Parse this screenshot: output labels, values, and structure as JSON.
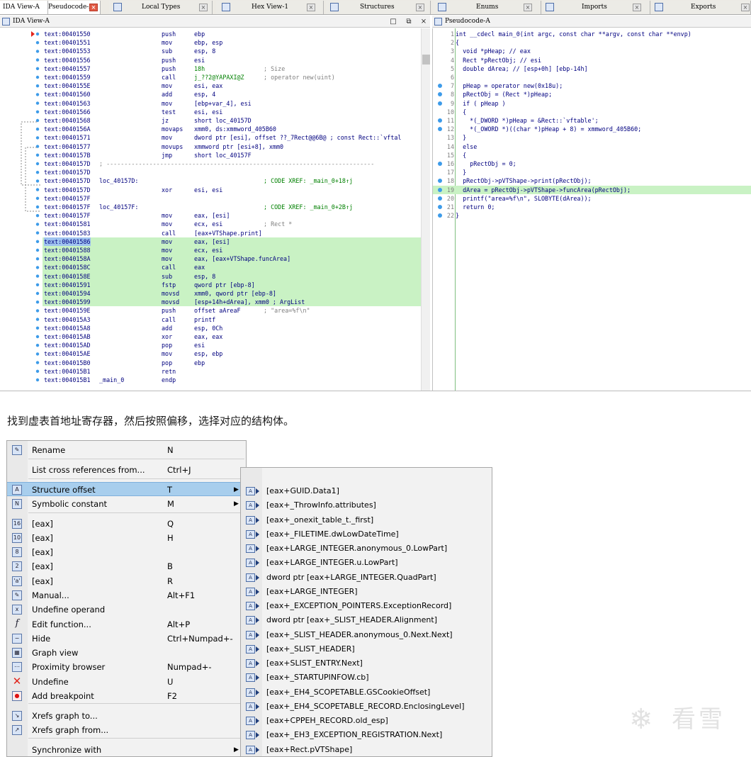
{
  "tabs": [
    {
      "label": "IDA View-A",
      "close": "×"
    },
    {
      "label": "Pseudocode-A",
      "close": "×"
    },
    {
      "label": "Local Types",
      "close": "×"
    },
    {
      "label": "Hex View-1",
      "close": "×"
    },
    {
      "label": "Structures",
      "close": "×"
    },
    {
      "label": "Enums",
      "close": "×"
    },
    {
      "label": "Imports",
      "close": "×"
    },
    {
      "label": "Exports",
      "close": "×"
    }
  ],
  "left_pane": {
    "title": "IDA View-A",
    "controls": [
      "□",
      "⧉",
      "×"
    ],
    "lines": [
      {
        "addr": "text:00401550",
        "label": "",
        "mn": "push",
        "op": "ebp",
        "cm": ""
      },
      {
        "addr": "text:00401551",
        "label": "",
        "mn": "mov",
        "op": "ebp, esp",
        "cm": ""
      },
      {
        "addr": "text:00401553",
        "label": "",
        "mn": "sub",
        "op": "esp, 8",
        "cm": ""
      },
      {
        "addr": "text:00401556",
        "label": "",
        "mn": "push",
        "op": "esi",
        "cm": ""
      },
      {
        "addr": "text:00401557",
        "label": "",
        "mn": "push",
        "op": "18h",
        "cm": "; Size"
      },
      {
        "addr": "text:00401559",
        "label": "",
        "mn": "call",
        "op": "j_??2@YAPAXI@Z",
        "cm": "; operator new(uint)"
      },
      {
        "addr": "text:0040155E",
        "label": "",
        "mn": "mov",
        "op": "esi, eax",
        "cm": ""
      },
      {
        "addr": "text:00401560",
        "label": "",
        "mn": "add",
        "op": "esp, 4",
        "cm": ""
      },
      {
        "addr": "text:00401563",
        "label": "",
        "mn": "mov",
        "op": "[ebp+var_4], esi",
        "cm": ""
      },
      {
        "addr": "text:00401566",
        "label": "",
        "mn": "test",
        "op": "esi, esi",
        "cm": ""
      },
      {
        "addr": "text:00401568",
        "label": "",
        "mn": "jz",
        "op": "short loc_40157D",
        "cm": ""
      },
      {
        "addr": "text:0040156A",
        "label": "",
        "mn": "movaps",
        "op": "xmm0, ds:xmmword_405B60",
        "cm": ""
      },
      {
        "addr": "text:00401571",
        "label": "",
        "mn": "mov",
        "op": "dword ptr [esi], offset ??_7Rect@@6B@ ; const Rect::`vftal",
        "cm": ""
      },
      {
        "addr": "text:00401577",
        "label": "",
        "mn": "movups",
        "op": "xmmword ptr [esi+8], xmm0",
        "cm": ""
      },
      {
        "addr": "text:0040157B",
        "label": "",
        "mn": "jmp",
        "op": "short loc_40157F",
        "cm": ""
      },
      {
        "addr": "text:0040157D",
        "label": "; ---------------------------------------------------------------------------",
        "mn": "",
        "op": "",
        "cm": ""
      },
      {
        "addr": "text:0040157D",
        "label": "",
        "mn": "",
        "op": "",
        "cm": ""
      },
      {
        "addr": "text:0040157D",
        "label": "loc_40157D:",
        "mn": "",
        "op": "",
        "cm": "; CODE XREF: _main_0+18↑j"
      },
      {
        "addr": "text:0040157D",
        "label": "",
        "mn": "xor",
        "op": "esi, esi",
        "cm": ""
      },
      {
        "addr": "text:0040157F",
        "label": "",
        "mn": "",
        "op": "",
        "cm": ""
      },
      {
        "addr": "text:0040157F",
        "label": "loc_40157F:",
        "mn": "",
        "op": "",
        "cm": "; CODE XREF: _main_0+2B↑j"
      },
      {
        "addr": "text:0040157F",
        "label": "",
        "mn": "mov",
        "op": "eax, [esi]",
        "cm": ""
      },
      {
        "addr": "text:00401581",
        "label": "",
        "mn": "mov",
        "op": "ecx, esi",
        "cm": "; Rect *"
      },
      {
        "addr": "text:00401583",
        "label": "",
        "mn": "call",
        "op": "[eax+VTShape.print]",
        "cm": ""
      },
      {
        "addr": "text:00401586",
        "label": "",
        "mn": "mov",
        "op": "eax, [esi]",
        "cm": ""
      },
      {
        "addr": "text:00401588",
        "label": "",
        "mn": "mov",
        "op": "ecx, esi",
        "cm": ""
      },
      {
        "addr": "text:0040158A",
        "label": "",
        "mn": "mov",
        "op": "eax, [eax+VTShape.funcArea]",
        "cm": ""
      },
      {
        "addr": "text:0040158C",
        "label": "",
        "mn": "call",
        "op": "eax",
        "cm": ""
      },
      {
        "addr": "text:0040158E",
        "label": "",
        "mn": "sub",
        "op": "esp, 8",
        "cm": ""
      },
      {
        "addr": "text:00401591",
        "label": "",
        "mn": "fstp",
        "op": "qword ptr [ebp-8]",
        "cm": ""
      },
      {
        "addr": "text:00401594",
        "label": "",
        "mn": "movsd",
        "op": "xmm0, qword ptr [ebp-8]",
        "cm": ""
      },
      {
        "addr": "text:00401599",
        "label": "",
        "mn": "movsd",
        "op": "[esp+14h+dArea], xmm0 ; ArgList",
        "cm": ""
      },
      {
        "addr": "text:0040159E",
        "label": "",
        "mn": "push",
        "op": "offset aAreaF",
        "cm": "; \"area=%f\\n\""
      },
      {
        "addr": "text:004015A3",
        "label": "",
        "mn": "call",
        "op": "printf",
        "cm": ""
      },
      {
        "addr": "text:004015A8",
        "label": "",
        "mn": "add",
        "op": "esp, 0Ch",
        "cm": ""
      },
      {
        "addr": "text:004015AB",
        "label": "",
        "mn": "xor",
        "op": "eax, eax",
        "cm": ""
      },
      {
        "addr": "text:004015AD",
        "label": "",
        "mn": "pop",
        "op": "esi",
        "cm": ""
      },
      {
        "addr": "text:004015AE",
        "label": "",
        "mn": "mov",
        "op": "esp, ebp",
        "cm": ""
      },
      {
        "addr": "text:004015B0",
        "label": "",
        "mn": "pop",
        "op": "ebp",
        "cm": ""
      },
      {
        "addr": "text:004015B1",
        "label": "",
        "mn": "retn",
        "op": "",
        "cm": ""
      },
      {
        "addr": "text:004015B1",
        "label": "_main_0",
        "mn": "endp",
        "op": "",
        "cm": ""
      }
    ]
  },
  "right_pane": {
    "title": "Pseudocode-A",
    "lines": [
      {
        "n": "1",
        "code": "int __cdecl main_0(int argc, const char **argv, const char **envp)"
      },
      {
        "n": "2",
        "code": "{"
      },
      {
        "n": "3",
        "code": "  void *pHeap; // eax"
      },
      {
        "n": "4",
        "code": "  Rect *pRectObj; // esi"
      },
      {
        "n": "5",
        "code": "  double dArea; // [esp+0h] [ebp-14h]"
      },
      {
        "n": "6",
        "code": ""
      },
      {
        "n": "7",
        "code": "  pHeap = operator new(0x18u);"
      },
      {
        "n": "8",
        "code": "  pRectObj = (Rect *)pHeap;"
      },
      {
        "n": "9",
        "code": "  if ( pHeap )"
      },
      {
        "n": "10",
        "code": "  {"
      },
      {
        "n": "11",
        "code": "    *(_DWORD *)pHeap = &Rect::`vftable';"
      },
      {
        "n": "12",
        "code": "    *(_OWORD *)((char *)pHeap + 8) = xmmword_405B60;"
      },
      {
        "n": "13",
        "code": "  }"
      },
      {
        "n": "14",
        "code": "  else"
      },
      {
        "n": "15",
        "code": "  {"
      },
      {
        "n": "16",
        "code": "    pRectObj = 0;"
      },
      {
        "n": "17",
        "code": "  }"
      },
      {
        "n": "18",
        "code": "  pRectObj->pVTShape->print(pRectObj);"
      },
      {
        "n": "19",
        "code": "  dArea = pRectObj->pVTShape->funcArea(pRectObj);"
      },
      {
        "n": "20",
        "code": "  printf(\"area=%f\\n\", SLOBYTE(dArea));"
      },
      {
        "n": "21",
        "code": "  return 0;"
      },
      {
        "n": "22",
        "code": "}"
      }
    ]
  },
  "caption": "找到虚表首地址寄存器，然后按照偏移，选择对应的结构体。",
  "context_menu": {
    "items": [
      {
        "label": "Rename",
        "key": "N",
        "icon": "rename-icon",
        "arrow": ""
      },
      {
        "label": "List cross references from...",
        "key": "Ctrl+J",
        "icon": "",
        "arrow": ""
      },
      {
        "label": "Structure offset",
        "key": "T",
        "icon": "structure-offset-icon",
        "arrow": "▶"
      },
      {
        "label": "Symbolic constant",
        "key": "M",
        "icon": "symbolic-constant-icon",
        "arrow": "▶"
      },
      {
        "label": "[eax]",
        "key": "Q",
        "icon": "hex-icon",
        "arrow": ""
      },
      {
        "label": "[eax]",
        "key": "H",
        "icon": "decimal-icon",
        "arrow": ""
      },
      {
        "label": "[eax]",
        "key": "",
        "icon": "octal-icon",
        "arrow": ""
      },
      {
        "label": "[eax]",
        "key": "B",
        "icon": "binary-icon",
        "arrow": ""
      },
      {
        "label": "[eax]",
        "key": "R",
        "icon": "char-icon",
        "arrow": ""
      },
      {
        "label": "Manual...",
        "key": "Alt+F1",
        "icon": "manual-icon",
        "arrow": ""
      },
      {
        "label": "Undefine operand",
        "key": "",
        "icon": "undefine-operand-icon",
        "arrow": ""
      },
      {
        "label": "Edit function...",
        "key": "Alt+P",
        "icon": "function-icon",
        "arrow": ""
      },
      {
        "label": "Hide",
        "key": "Ctrl+Numpad+-",
        "icon": "hide-icon",
        "arrow": ""
      },
      {
        "label": "Graph view",
        "key": "",
        "icon": "graph-view-icon",
        "arrow": ""
      },
      {
        "label": "Proximity browser",
        "key": "Numpad+-",
        "icon": "proximity-icon",
        "arrow": ""
      },
      {
        "label": "Undefine",
        "key": "U",
        "icon": "undefine-icon",
        "arrow": ""
      },
      {
        "label": "Add breakpoint",
        "key": "F2",
        "icon": "breakpoint-icon",
        "arrow": ""
      },
      {
        "label": "Xrefs graph to...",
        "key": "",
        "icon": "xrefs-to-icon",
        "arrow": ""
      },
      {
        "label": "Xrefs graph from...",
        "key": "",
        "icon": "xrefs-from-icon",
        "arrow": ""
      },
      {
        "label": "Synchronize with",
        "key": "",
        "icon": "",
        "arrow": "▶"
      }
    ]
  },
  "submenu": {
    "items": [
      "[eax+GUID.Data1]",
      "[eax+_ThrowInfo.attributes]",
      "[eax+_onexit_table_t._first]",
      "[eax+_FILETIME.dwLowDateTime]",
      "[eax+LARGE_INTEGER.anonymous_0.LowPart]",
      "[eax+LARGE_INTEGER.u.LowPart]",
      "dword ptr [eax+LARGE_INTEGER.QuadPart]",
      "[eax+LARGE_INTEGER]",
      "[eax+_EXCEPTION_POINTERS.ExceptionRecord]",
      "dword ptr [eax+_SLIST_HEADER.Alignment]",
      "[eax+_SLIST_HEADER.anonymous_0.Next.Next]",
      "[eax+_SLIST_HEADER]",
      "[eax+SLIST_ENTRY.Next]",
      "[eax+_STARTUPINFOW.cb]",
      "[eax+_EH4_SCOPETABLE.GSCookieOffset]",
      "[eax+_EH4_SCOPETABLE_RECORD.EnclosingLevel]",
      "[eax+CPPEH_RECORD.old_esp]",
      "[eax+_EH3_EXCEPTION_REGISTRATION.Next]",
      "[eax+Rect.pVTShape]"
    ]
  },
  "watermark": "看雪"
}
